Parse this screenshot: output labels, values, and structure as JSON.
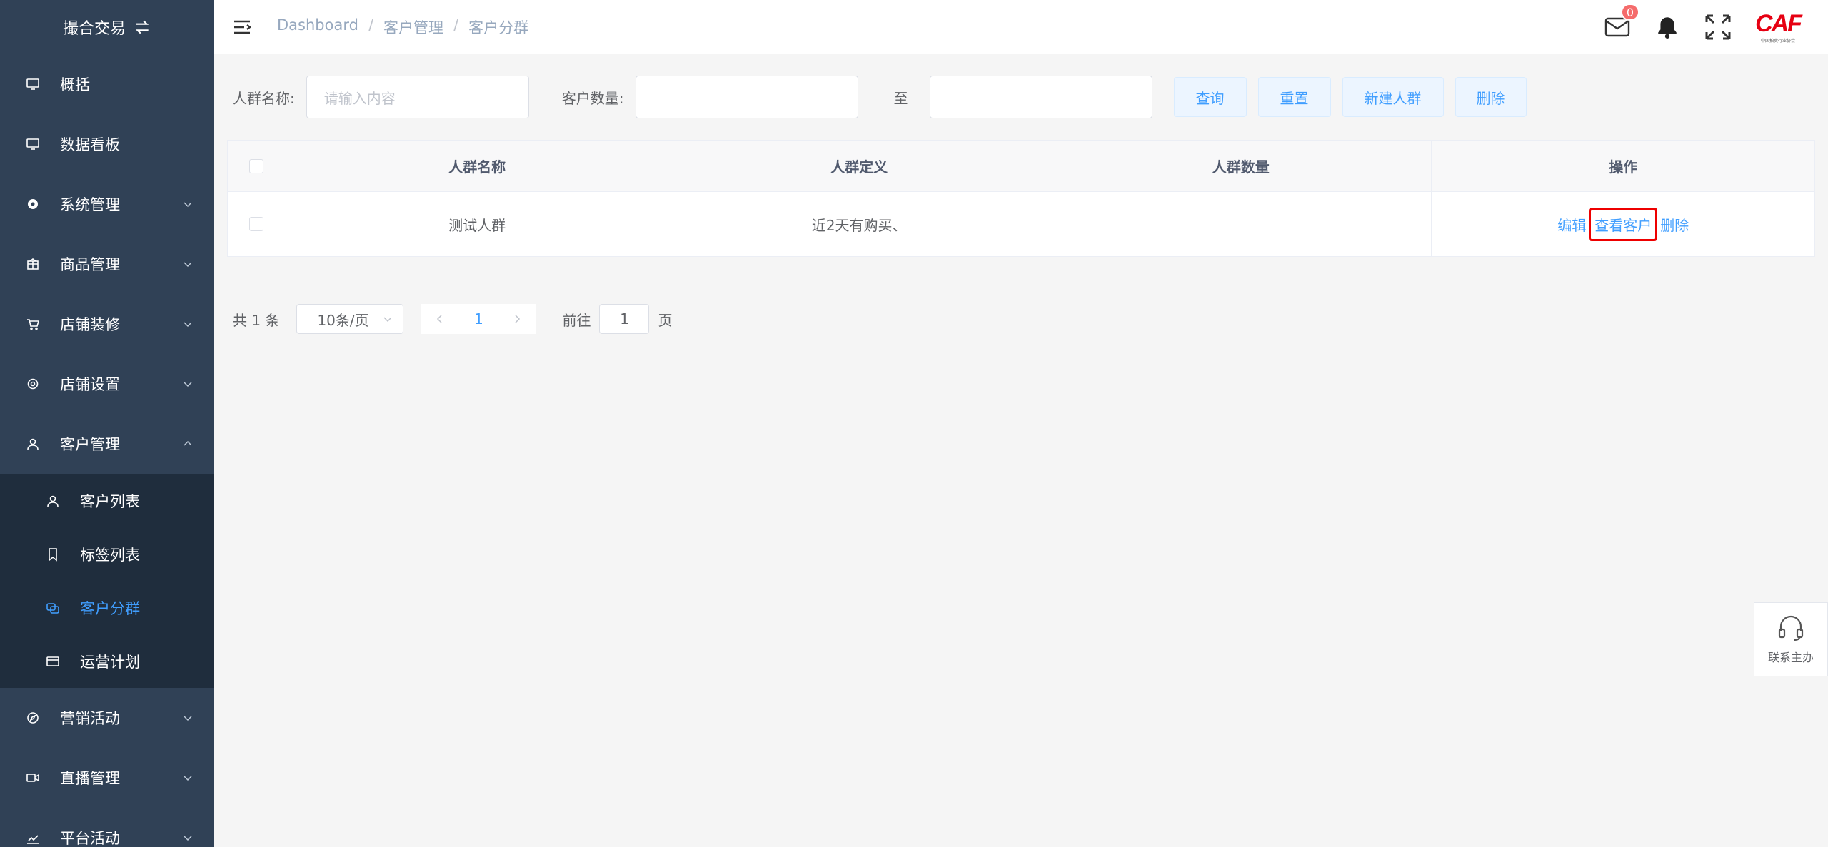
{
  "sidebar": {
    "title": "撮合交易",
    "items": [
      {
        "label": "概括",
        "icon": "monitor-icon",
        "has_arrow": false
      },
      {
        "label": "数据看板",
        "icon": "monitor-icon",
        "has_arrow": false
      },
      {
        "label": "系统管理",
        "icon": "gear-filled-icon",
        "has_arrow": true
      },
      {
        "label": "商品管理",
        "icon": "shop-icon",
        "has_arrow": true
      },
      {
        "label": "店铺装修",
        "icon": "cart-icon",
        "has_arrow": true
      },
      {
        "label": "店铺设置",
        "icon": "settings-icon",
        "has_arrow": true
      },
      {
        "label": "客户管理",
        "icon": "user-icon",
        "has_arrow": true,
        "expanded": true
      }
    ],
    "submenu": [
      {
        "label": "客户列表",
        "icon": "user-icon"
      },
      {
        "label": "标签列表",
        "icon": "bookmark-icon"
      },
      {
        "label": "客户分群",
        "icon": "group-icon",
        "active": true
      },
      {
        "label": "运营计划",
        "icon": "card-icon"
      }
    ],
    "items_after": [
      {
        "label": "营销活动",
        "icon": "compass-icon"
      },
      {
        "label": "直播管理",
        "icon": "video-icon"
      },
      {
        "label": "平台活动",
        "icon": "chart-icon"
      }
    ]
  },
  "header": {
    "breadcrumb": [
      "Dashboard",
      "客户管理",
      "客户分群"
    ],
    "separator": "/",
    "mail_badge": "0",
    "logo_text": "CAF",
    "logo_sub": "中国拍卖行业协会"
  },
  "filters": {
    "name_label": "人群名称:",
    "name_placeholder": "请输入内容",
    "count_label": "客户数量:",
    "to_label": "至",
    "buttons": [
      "查询",
      "重置",
      "新建人群",
      "删除"
    ]
  },
  "table": {
    "columns": [
      "人群名称",
      "人群定义",
      "人群数量",
      "操作"
    ],
    "rows": [
      {
        "name": "测试人群",
        "definition": "近2天有购买、",
        "count": "",
        "ops": [
          "编辑",
          "查看客户",
          "删除"
        ]
      }
    ]
  },
  "pagination": {
    "total": "共 1 条",
    "page_size": "10条/页",
    "current": "1",
    "goto_label": "前往",
    "goto_value": "1",
    "page_suffix": "页"
  },
  "contact": {
    "label": "联系主办"
  },
  "colors": {
    "sidebar_bg": "#304156",
    "submenu_bg": "#1f2d3d",
    "accent": "#409eff",
    "badge": "#f56c6c",
    "highlight": "#e00000"
  }
}
